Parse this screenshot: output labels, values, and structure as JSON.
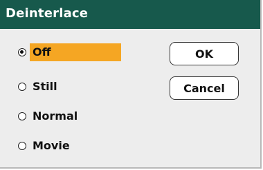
{
  "dialog": {
    "title": "Deinterlace",
    "options": [
      {
        "label": "Off",
        "selected": true
      },
      {
        "label": "Still",
        "selected": false
      },
      {
        "label": "Normal",
        "selected": false
      },
      {
        "label": "Movie",
        "selected": false
      }
    ],
    "buttons": {
      "ok_label": "OK",
      "cancel_label": "Cancel"
    }
  },
  "colors": {
    "title_bar": "#17594c",
    "highlight": "#f5a623",
    "panel": "#ededed"
  }
}
